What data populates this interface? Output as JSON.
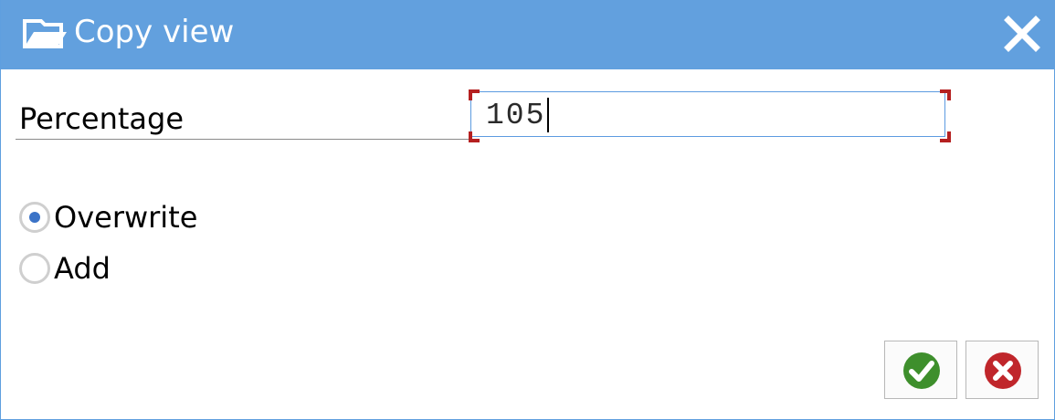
{
  "dialog": {
    "title": "Copy view",
    "title_icon": "copy-view-icon",
    "close_icon": "close-icon"
  },
  "field": {
    "label": "Percentage",
    "value": "105"
  },
  "options": [
    {
      "label": "Overwrite",
      "checked": true
    },
    {
      "label": "Add",
      "checked": false
    }
  ],
  "buttons": {
    "confirm_icon": "checkmark-icon",
    "cancel_icon": "cancel-x-icon"
  },
  "colors": {
    "titlebar": "#62a0de",
    "confirm": "#3e8f2c",
    "cancel": "#c0262b",
    "focus_corner": "#b52020"
  }
}
